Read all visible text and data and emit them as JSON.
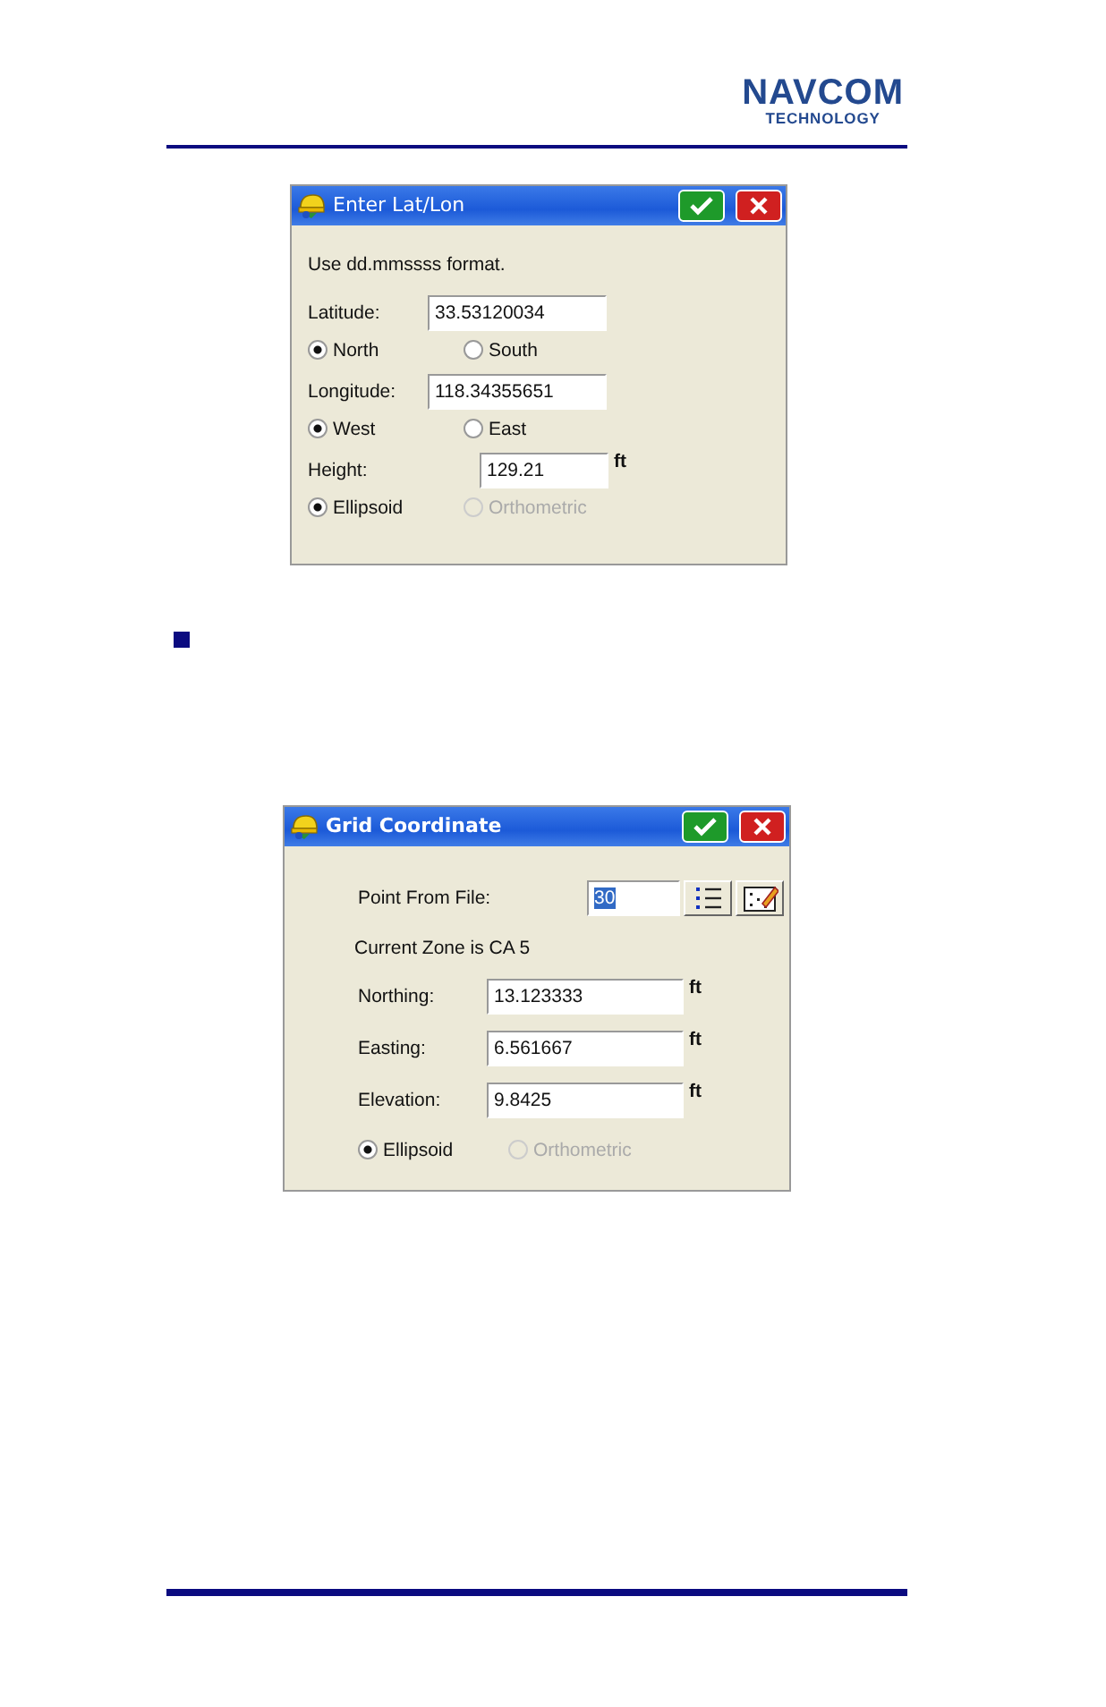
{
  "header": {
    "logo": {
      "line_1": "NAVCOM",
      "line_2": "TECHNOLOGY"
    }
  },
  "dialogs": [
    {
      "title": "Enter Lat/Lon",
      "rows": [
        {
          "kind": "text",
          "text": "Use dd.mmssss format."
        },
        {
          "kind": "field",
          "label": "Latitude:",
          "value": "33.53120034"
        },
        {
          "kind": "radios",
          "options": [
            {
              "label": "North",
              "selected": true,
              "disabled": false
            },
            {
              "label": "South",
              "selected": false,
              "disabled": false
            }
          ]
        },
        {
          "kind": "field",
          "label": "Longitude:",
          "value": "118.34355651"
        },
        {
          "kind": "radios",
          "options": [
            {
              "label": "West",
              "selected": true,
              "disabled": false
            },
            {
              "label": "East",
              "selected": false,
              "disabled": false
            }
          ]
        },
        {
          "kind": "field",
          "label": "Height:",
          "value": "129.21",
          "unit": "ft"
        },
        {
          "kind": "radios",
          "options": [
            {
              "label": "Ellipsoid",
              "selected": true,
              "disabled": false
            },
            {
              "label": "Orthometric",
              "selected": false,
              "disabled": true
            }
          ]
        }
      ]
    },
    {
      "title": "Grid Coordinate",
      "rows": [
        {
          "kind": "file_field",
          "label": "Point From File:",
          "value": "30"
        },
        {
          "kind": "text",
          "text": "Current Zone is  CA 5"
        },
        {
          "kind": "field",
          "label": "Northing:",
          "value": "13.123333",
          "unit": "ft"
        },
        {
          "kind": "field",
          "label": "Easting:",
          "value": "6.561667",
          "unit": "ft"
        },
        {
          "kind": "field",
          "label": "Elevation:",
          "value": "9.8425",
          "unit": "ft"
        },
        {
          "kind": "radios",
          "options": [
            {
              "label": "Ellipsoid",
              "selected": true,
              "disabled": false
            },
            {
              "label": "Orthometric",
              "selected": false,
              "disabled": true
            }
          ]
        }
      ]
    }
  ]
}
